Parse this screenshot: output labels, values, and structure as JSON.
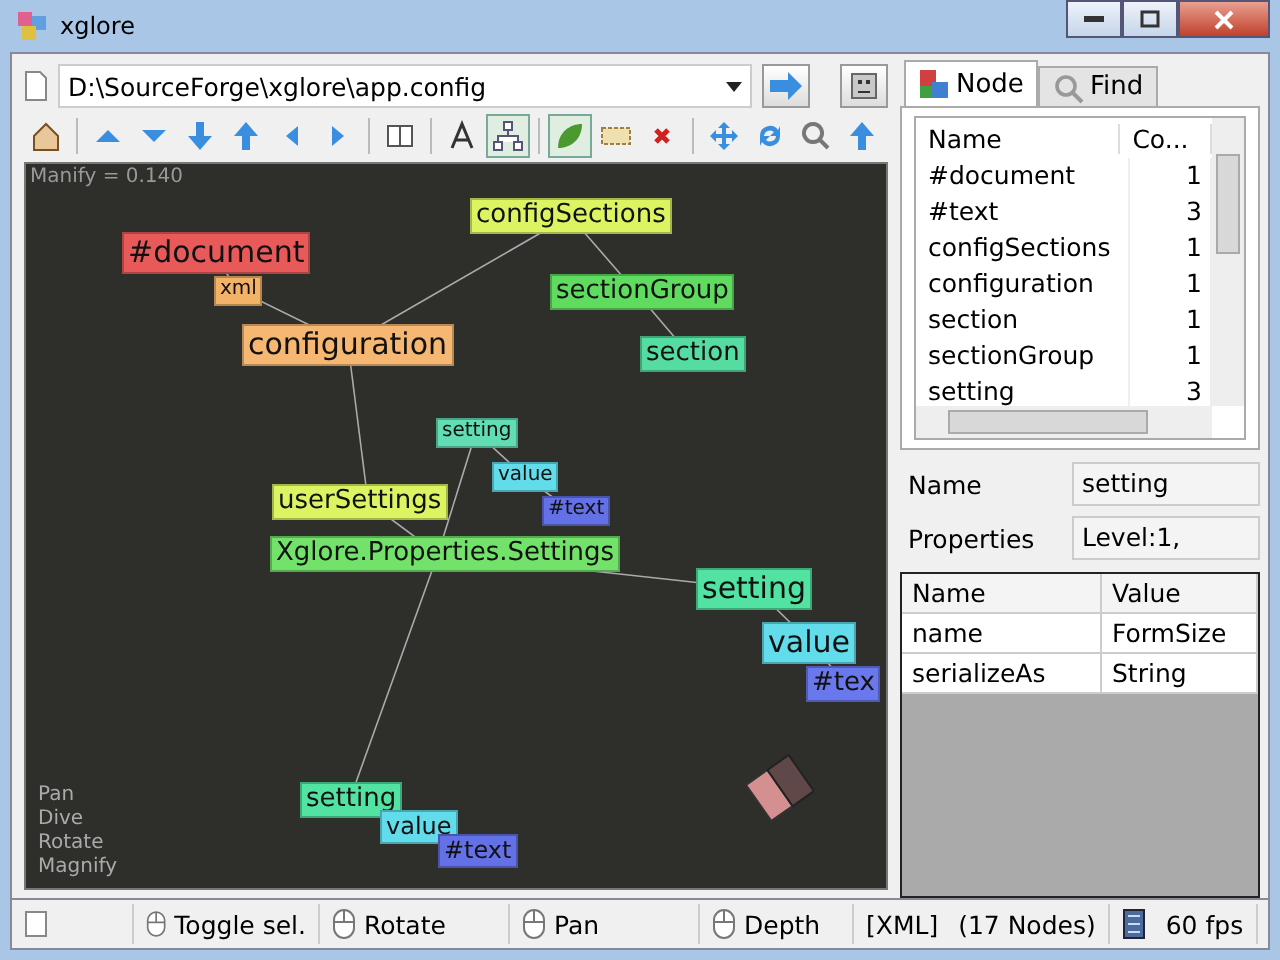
{
  "window": {
    "title": "xglore"
  },
  "address": {
    "value": "D:\\SourceForge\\xglore\\app.config"
  },
  "toolbar": [
    {
      "pressed": false
    },
    {
      "pressed": false
    },
    {
      "pressed": false
    },
    {
      "pressed": false
    },
    {
      "pressed": false
    },
    {
      "pressed": false
    },
    {
      "pressed": false
    },
    {
      "pressed": false
    },
    {
      "pressed": false
    },
    {
      "pressed": true
    },
    {
      "pressed": true
    },
    {
      "pressed": false
    },
    {
      "pressed": false
    },
    {
      "pressed": false
    },
    {
      "pressed": false
    },
    {
      "pressed": false
    },
    {
      "pressed": false
    }
  ],
  "canvas": {
    "caption": "Manify = 0.140",
    "hints": [
      "Pan",
      "Dive",
      "Rotate",
      "Magnify"
    ],
    "nodes": [
      {
        "label": "#document",
        "color": "#e85a5a"
      },
      {
        "label": "xml",
        "color": "#f2b368"
      },
      {
        "label": "configuration",
        "color": "#f5b772"
      },
      {
        "label": "configSections",
        "color": "#dcf462"
      },
      {
        "label": "sectionGroup",
        "color": "#5fdc5f"
      },
      {
        "label": "section",
        "color": "#55dca0"
      },
      {
        "label": "setting",
        "color": "#62dcb2"
      },
      {
        "label": "value",
        "color": "#62dcea"
      },
      {
        "label": "#text",
        "color": "#6470e6"
      },
      {
        "label": "userSettings",
        "color": "#dcf462"
      },
      {
        "label": "Xglore.Properties.Settings",
        "color": "#72e26a"
      },
      {
        "label": "setting",
        "color": "#52e2a2"
      },
      {
        "label": "value",
        "color": "#62dcea"
      },
      {
        "label": "#tex",
        "color": "#6a78ee"
      },
      {
        "label": "setting",
        "color": "#52e2a2"
      },
      {
        "label": "value",
        "color": "#62dcea"
      },
      {
        "label": "#text",
        "color": "#6470e6"
      }
    ]
  },
  "tabs": [
    {
      "label": "Node",
      "selected": true
    },
    {
      "label": "Find",
      "selected": false
    }
  ],
  "node_table": {
    "columns": [
      "Name",
      "Co..."
    ],
    "rows": [
      [
        "#document",
        "1"
      ],
      [
        "#text",
        "3"
      ],
      [
        "configSections",
        "1"
      ],
      [
        "configuration",
        "1"
      ],
      [
        "section",
        "1"
      ],
      [
        "sectionGroup",
        "1"
      ],
      [
        "setting",
        "3"
      ]
    ]
  },
  "details": {
    "name_label": "Name",
    "name_value": "setting",
    "properties_label": "Properties",
    "properties_value": "Level:1,"
  },
  "properties_table": {
    "columns": [
      "Name",
      "Value"
    ],
    "rows": [
      [
        "name",
        "FormSize"
      ],
      [
        "serializeAs",
        "String"
      ]
    ]
  },
  "status_bar": {
    "items": [
      "Toggle sel.",
      "Rotate",
      "Pan",
      "Depth",
      "[XML]",
      "(17 Nodes)",
      "60 fps"
    ]
  }
}
